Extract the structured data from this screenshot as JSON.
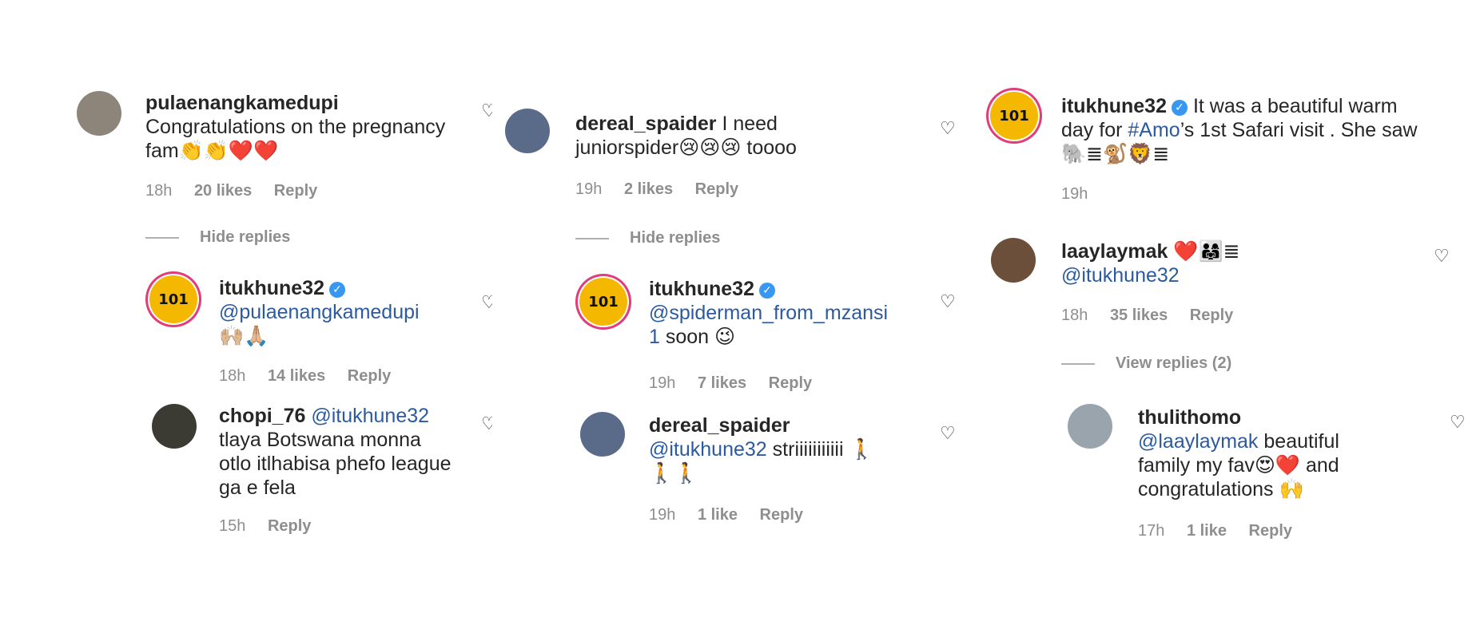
{
  "columns": [
    {
      "comments": [
        {
          "username": "pulaenangkamedupi",
          "text": "Congratulations on the pregnancy fam👏👏❤️❤️",
          "time": "18h",
          "likes": "20 likes",
          "reply": "Reply"
        },
        {
          "username": "itukhune32",
          "verified": true,
          "mention": "@pulaenangkamedupi",
          "text": "🙌🏼🙏🏼",
          "time": "18h",
          "likes": "14 likes",
          "reply": "Reply"
        },
        {
          "username": "chopi_76",
          "mention": "@itukhune32",
          "text": "tlaya Botswana monna otlo itlhabisa phefo league ga e fela",
          "time": "15h",
          "reply": "Reply"
        }
      ],
      "divider": "Hide replies"
    },
    {
      "comments": [
        {
          "username": "dereal_spaider",
          "text": "I need juniorspider😢😢😢 toooo",
          "time": "19h",
          "likes": "2 likes",
          "reply": "Reply"
        },
        {
          "username": "itukhune32",
          "verified": true,
          "mention": "@spiderman_from_mzansi1",
          "text": "soon 😉",
          "time": "19h",
          "likes": "7 likes",
          "reply": "Reply"
        },
        {
          "username": "dereal_spaider",
          "mention": "@itukhune32",
          "text": "striiiiiiiiiii 🚶🚶🚶",
          "time": "19h",
          "likes": "1 like",
          "reply": "Reply"
        }
      ],
      "divider": "Hide replies"
    },
    {
      "comments": [
        {
          "username": "itukhune32",
          "verified": true,
          "text_before": "It was a beautiful warm day for",
          "hashtag": "#Amo",
          "text_after": "’s 1st Safari visit . She saw 🐘≣🐒🦁≣",
          "time": "19h"
        },
        {
          "username": "laaylaymak",
          "text": "❤️👨‍👩‍👧≣",
          "mention": "@itukhune32",
          "time": "18h",
          "likes": "35 likes",
          "reply": "Reply"
        },
        {
          "username": "thulithomo",
          "mention": "@laaylaymak",
          "text": "beautiful family my fav😍❤️ and congratulations 🙌",
          "time": "17h",
          "likes": "1 like",
          "reply": "Reply"
        }
      ],
      "divider": "View replies (2)"
    }
  ],
  "icons": {
    "heart": "heart-outline-icon",
    "verified": "verified-badge-icon"
  },
  "avatar_brand_text": "101",
  "colors": {
    "mention": "#2c5aa0",
    "meta": "#8e8e8e",
    "verified": "#3897f0",
    "brand_ring": "#e13d7a",
    "brand_fill": "#f5b800"
  }
}
